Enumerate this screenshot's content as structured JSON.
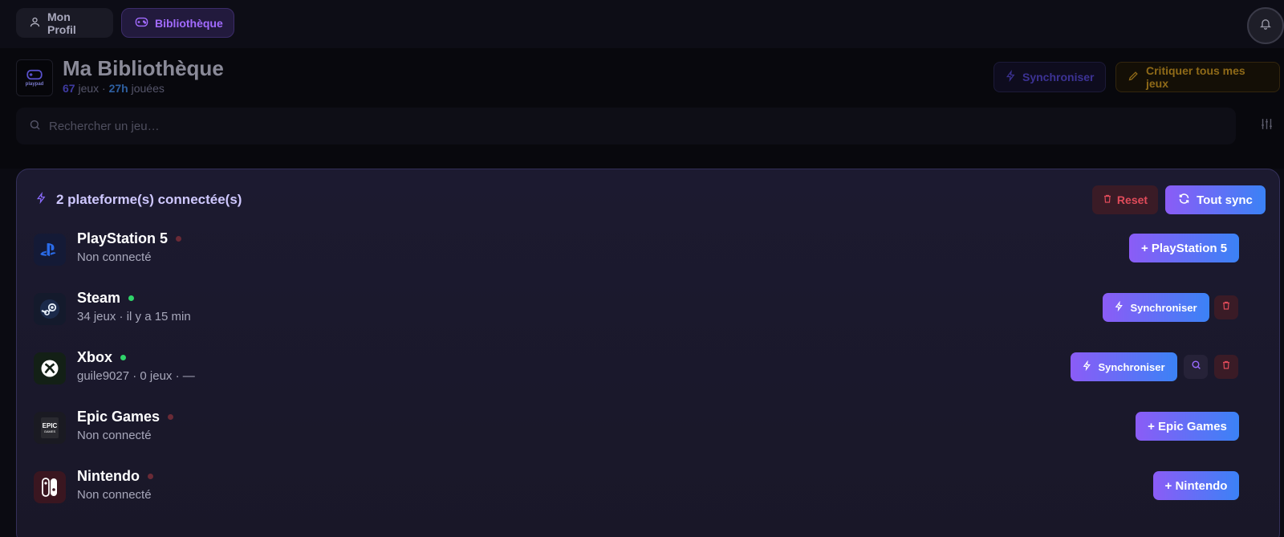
{
  "nav": {
    "profile_label": "Mon Profil",
    "library_label": "Bibliothèque"
  },
  "header": {
    "title": "Ma Bibliothèque",
    "logo_text": "playpad",
    "games_count": "67",
    "games_word": "jeux",
    "separator": "·",
    "hours": "27h",
    "hours_word": "jouées",
    "sync_label": "Synchroniser",
    "critique_label": "Critiquer tous mes jeux"
  },
  "search": {
    "placeholder": "Rechercher un jeu…"
  },
  "panel": {
    "heading": "2 plateforme(s) connectée(s)",
    "reset_label": "Reset",
    "sync_all_label": "Tout sync",
    "platforms": [
      {
        "name": "PlayStation 5",
        "status": "disconnected",
        "subtitle": "Non connecté",
        "action_label": "+ PlayStation 5"
      },
      {
        "name": "Steam",
        "status": "connected",
        "subtitle": "34 jeux · il y a 15 min",
        "action_label": "Synchroniser"
      },
      {
        "name": "Xbox",
        "status": "connected",
        "subtitle": "guile9027 · 0 jeux · —",
        "action_label": "Synchroniser"
      },
      {
        "name": "Epic Games",
        "status": "disconnected",
        "subtitle": "Non connecté",
        "action_label": "+ Epic Games",
        "icon_text": "EPIC",
        "icon_subtext": "GAMES"
      },
      {
        "name": "Nintendo",
        "status": "disconnected",
        "subtitle": "Non connecté",
        "action_label": "+ Nintendo"
      }
    ]
  },
  "colors": {
    "accent_purple": "#8b5cf6",
    "accent_blue": "#3b82f6",
    "connected_green": "#2fd46a",
    "danger_red": "#e04b5a",
    "critique_gold": "#8f6a18"
  },
  "icons": {
    "profile": "user-icon",
    "library": "gamepad-icon",
    "notifications": "bell-icon",
    "search": "search-icon",
    "filters": "sliders-icon",
    "sync": "bolt-icon",
    "critique": "pencil-icon",
    "reset": "trash-icon",
    "sync_all": "refresh-icon"
  }
}
